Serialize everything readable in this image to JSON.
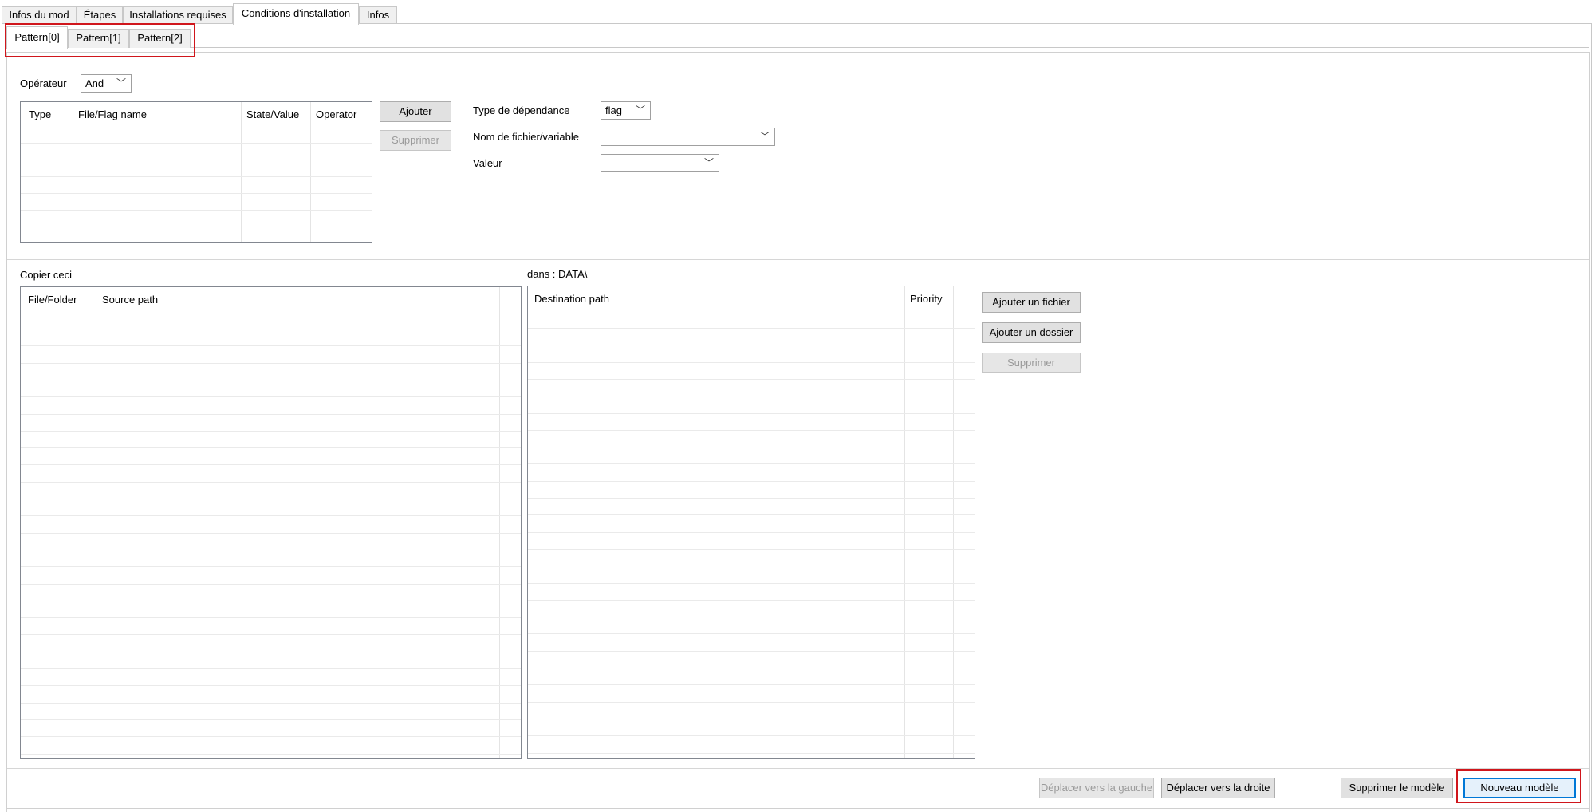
{
  "main_tabs": [
    "Infos du mod",
    "Étapes",
    "Installations requises",
    "Conditions d'installation",
    "Infos"
  ],
  "active_main_tab": 3,
  "pattern_tabs": [
    "Pattern[0]",
    "Pattern[1]",
    "Pattern[2]"
  ],
  "active_pattern_tab": 0,
  "conditions": {
    "operator_label": "Opérateur",
    "operator_value": "And",
    "columns": [
      "Type",
      "File/Flag name",
      "State/Value",
      "Operator"
    ],
    "add_label": "Ajouter",
    "remove_label": "Supprimer",
    "dependency_type_label": "Type de dépendance",
    "dependency_type_value": "flag",
    "filename_label": "Nom de fichier/variable",
    "filename_value": "",
    "value_label": "Valeur",
    "value_value": ""
  },
  "copy": {
    "copy_label": "Copier ceci",
    "dest_label": "dans : DATA\\",
    "source_columns": [
      "File/Folder",
      "Source path"
    ],
    "dest_columns": [
      "Destination path",
      "Priority"
    ],
    "add_file_label": "Ajouter un fichier",
    "add_folder_label": "Ajouter un dossier",
    "remove_label": "Supprimer"
  },
  "footer": {
    "move_left_label": "Déplacer vers la gauche",
    "move_right_label": "Déplacer vers la droite",
    "delete_pattern_label": "Supprimer le modèle",
    "new_pattern_label": "Nouveau modèle"
  }
}
